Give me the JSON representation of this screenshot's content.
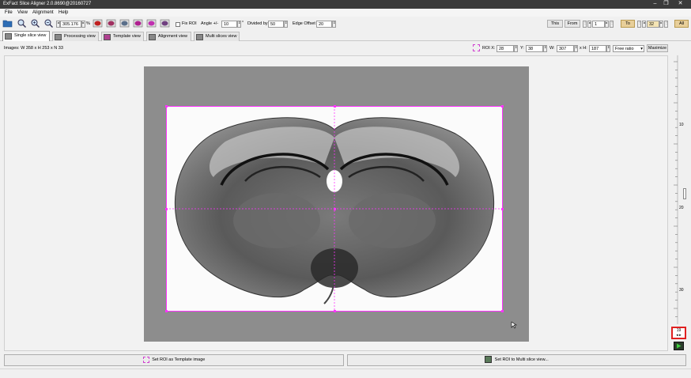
{
  "window": {
    "title": "ExFact Slice Aligner 2.0.8690@20160727"
  },
  "menu": [
    "File",
    "View",
    "Alignment",
    "Help"
  ],
  "toolbar": {
    "zoom_value": "305.176",
    "zoom_unit": "%",
    "fix_roi_label": "Fix ROI",
    "angle_label": "Angle +/-",
    "angle_value": "10",
    "degree_symbol": "°",
    "divided_by_label": "Divided by",
    "divided_by_value": "50",
    "edge_offset_label": "Edge Offset",
    "edge_offset_value": "20",
    "this_label": "This",
    "from_label": "From",
    "from_value": "1",
    "to_label": "To",
    "to_value": "32",
    "all_label": "All"
  },
  "tabs": [
    {
      "label": "Single slice view",
      "active": true
    },
    {
      "label": "Processing view",
      "active": false
    },
    {
      "label": "Template view",
      "active": false
    },
    {
      "label": "Alignment view",
      "active": false
    },
    {
      "label": "Multi slices view",
      "active": false
    }
  ],
  "info": {
    "images_text": "Images: W 358 x H 253 x N 33",
    "roi_x_label": "ROI X:",
    "roi_x_value": "28",
    "y_label": "Y:",
    "y_value": "38",
    "w_label": "W:",
    "w_value": "307",
    "x_label": "x H:",
    "h_value": "187",
    "ratio_value": "Free ratio",
    "maximize_label": "Maximize"
  },
  "ruler": {
    "ticks": [
      "10",
      "20",
      "30"
    ]
  },
  "slice": {
    "current": "19",
    "arrows": "◂ ▸"
  },
  "bottom": {
    "set_template_label": "Set ROI as Template image",
    "set_multi_label": "Set ROI to Multi slice view..."
  },
  "colors": {
    "roi": "#ff33ff",
    "indicator": "#e02020"
  }
}
